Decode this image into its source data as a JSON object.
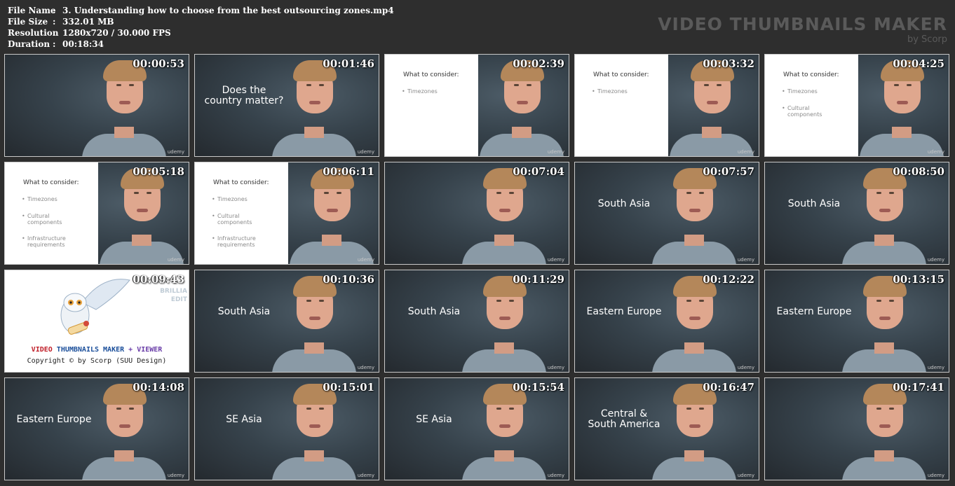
{
  "info": {
    "rows": [
      {
        "key": "File Name",
        "value": "3. Understanding how to choose from the best outsourcing zones.mp4"
      },
      {
        "key": "File Size",
        "value": "332.01 MB"
      },
      {
        "key": "Resolution",
        "value": "1280x720 / 30.000 FPS"
      },
      {
        "key": "Duration",
        "value": "00:18:34"
      }
    ],
    "colon": ":"
  },
  "brand": {
    "title": "VIDEO THUMBNAILS MAKER",
    "subtitle": "by Scorp"
  },
  "watermark": "udemy",
  "slide": {
    "title": "What to consider:",
    "items": [
      "Timezones",
      "Cultural components",
      "Infrastructure requirements"
    ]
  },
  "about": {
    "title_parts": [
      "VIDEO",
      "THUMBNAILS MAKER",
      "+ VIEWER"
    ],
    "title_colors": [
      "#c0202a",
      "#1a4e9a",
      "#6a3ea8"
    ],
    "copyright": "Copyright © by Scorp (SUU Design)",
    "side_text": [
      "BRILLIA",
      "EDIT"
    ]
  },
  "thumbnails": [
    {
      "time": "00:00:53",
      "kind": "cam",
      "overlay": ""
    },
    {
      "time": "00:01:46",
      "kind": "cam",
      "overlay": "Does the\ncountry matter?"
    },
    {
      "time": "00:02:39",
      "kind": "slide",
      "slide_items": 1
    },
    {
      "time": "00:03:32",
      "kind": "slide",
      "slide_items": 1
    },
    {
      "time": "00:04:25",
      "kind": "slide",
      "slide_items": 2
    },
    {
      "time": "00:05:18",
      "kind": "slide",
      "slide_items": 3
    },
    {
      "time": "00:06:11",
      "kind": "slide",
      "slide_items": 3
    },
    {
      "time": "00:07:04",
      "kind": "cam",
      "overlay": ""
    },
    {
      "time": "00:07:57",
      "kind": "cam",
      "overlay": "South Asia"
    },
    {
      "time": "00:08:50",
      "kind": "cam",
      "overlay": "South Asia"
    },
    {
      "time": "00:09:43",
      "kind": "about",
      "overlay": ""
    },
    {
      "time": "00:10:36",
      "kind": "cam",
      "overlay": "South Asia"
    },
    {
      "time": "00:11:29",
      "kind": "cam",
      "overlay": "South Asia"
    },
    {
      "time": "00:12:22",
      "kind": "cam",
      "overlay": "Eastern Europe"
    },
    {
      "time": "00:13:15",
      "kind": "cam",
      "overlay": "Eastern Europe"
    },
    {
      "time": "00:14:08",
      "kind": "cam",
      "overlay": "Eastern Europe"
    },
    {
      "time": "00:15:01",
      "kind": "cam",
      "overlay": "SE Asia"
    },
    {
      "time": "00:15:54",
      "kind": "cam",
      "overlay": "SE Asia"
    },
    {
      "time": "00:16:47",
      "kind": "cam",
      "overlay": "Central &\nSouth America"
    },
    {
      "time": "00:17:41",
      "kind": "cam",
      "overlay": ""
    }
  ]
}
